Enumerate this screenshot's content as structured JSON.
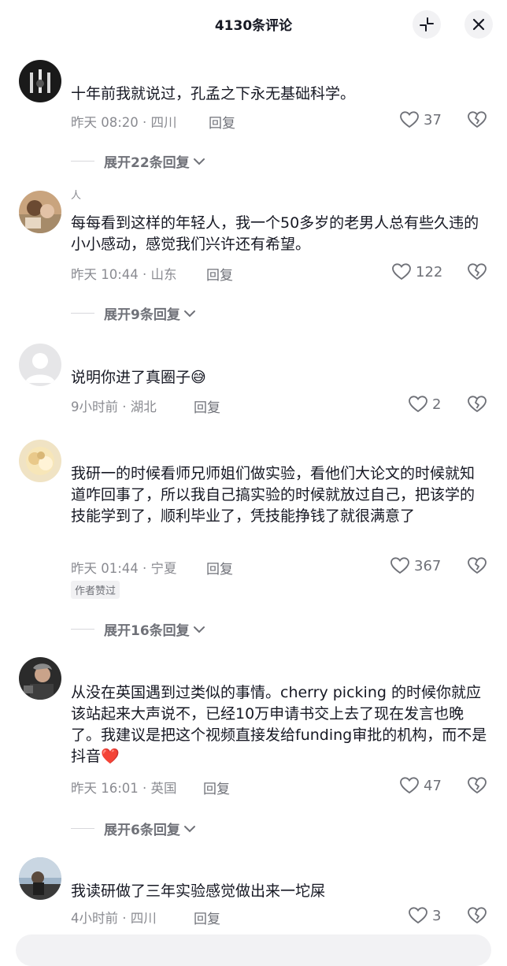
{
  "header": {
    "title": "4130条评论",
    "collapse_icon": "collapse-icon",
    "close_icon": "close-icon"
  },
  "comments": [
    {
      "username": "",
      "text": "十年前我就说过，孔孟之下永无基础科学。",
      "time_location": "昨天 08:20 · 四川",
      "reply_label": "回复",
      "likes": "37",
      "expand_label": "展开22条回复"
    },
    {
      "username": "人",
      "text": "每每看到这样的年轻人，我一个50多岁的老男人总有些久违的小小感动，感觉我们兴许还有希望。",
      "time_location": "昨天 10:44 · 山东",
      "reply_label": "回复",
      "likes": "122",
      "expand_label": "展开9条回复"
    },
    {
      "username": "",
      "text": "说明你进了真圈子😅",
      "time_location": "9小时前 · 湖北",
      "reply_label": "回复",
      "likes": "2"
    },
    {
      "username": "",
      "text": "我研一的时候看师兄师姐们做实验，看他们大论文的时候就知道咋回事了，所以我自己搞实验的时候就放过自己，把该学的技能学到了，顺利毕业了，凭技能挣钱了就很满意了",
      "time_location": "昨天 01:44 · 宁夏",
      "reply_label": "回复",
      "likes": "367",
      "author_badge": "作者赞过",
      "expand_label": "展开16条回复"
    },
    {
      "username": "",
      "text": "从没在英国遇到过类似的事情。cherry picking 的时候你就应该站起来大声说不，已经10万申请书交上去了现在发言也晚了。我建议是把这个视频直接发给funding审批的机构，而不是抖音❤️",
      "time_location": "昨天 16:01 · 英国",
      "reply_label": "回复",
      "likes": "47",
      "expand_label": "展开6条回复"
    },
    {
      "username": "",
      "text": "我读研做了三年实验感觉做出来一坨屎",
      "time_location": "4小时前 · 四川",
      "reply_label": "回复",
      "likes": "3"
    }
  ]
}
